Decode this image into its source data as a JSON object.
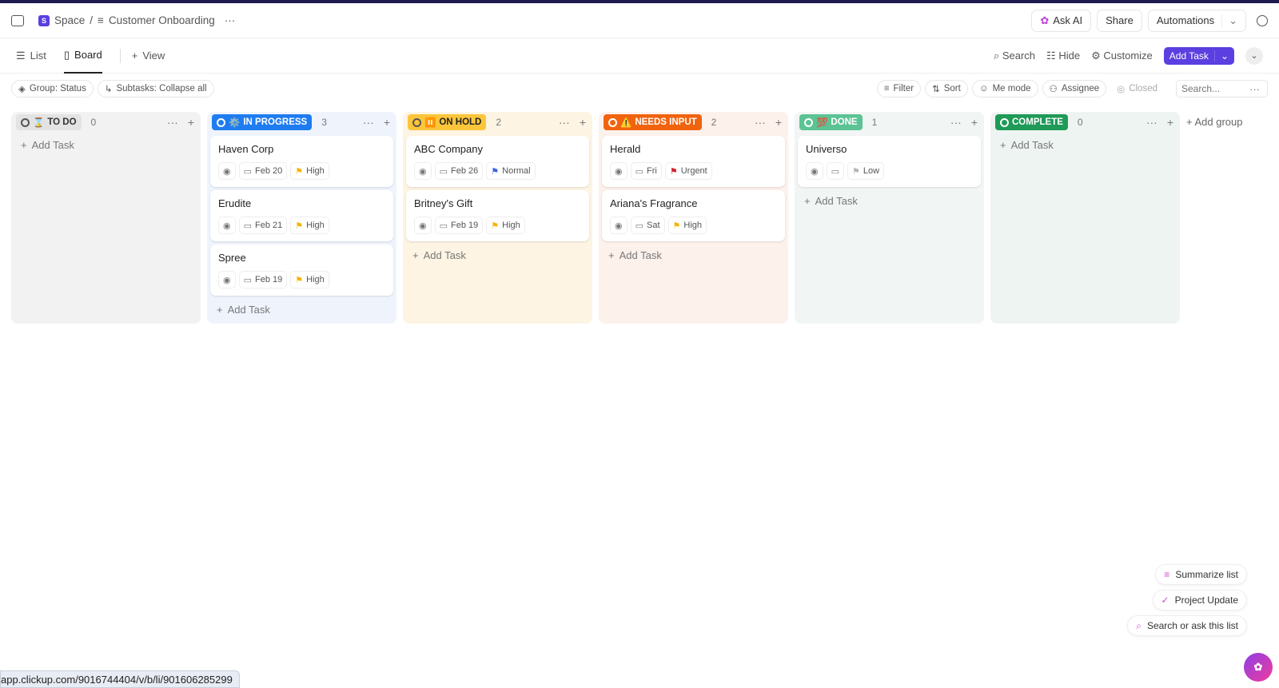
{
  "header": {
    "space": "Space",
    "space_initial": "S",
    "separator": "/",
    "list_name": "Customer Onboarding",
    "more": "···",
    "ask_ai": "Ask AI",
    "share": "Share",
    "automations": "Automations"
  },
  "views": {
    "list": "List",
    "board": "Board",
    "add_view": "View",
    "search": "Search",
    "hide": "Hide",
    "customize": "Customize",
    "add_task": "Add Task"
  },
  "filters": {
    "group": "Group: Status",
    "subtasks": "Subtasks: Collapse all",
    "filter": "Filter",
    "sort": "Sort",
    "me_mode": "Me mode",
    "assignee": "Assignee",
    "closed": "Closed",
    "search_placeholder": "Search..."
  },
  "columns": [
    {
      "name": "TO DO",
      "emoji": "⌛",
      "count": "0",
      "color": "#e3e3e3",
      "text": "#333",
      "bg": "#f2f2f2",
      "tasks": []
    },
    {
      "name": "IN PROGRESS",
      "emoji": "⚙️",
      "count": "3",
      "color": "#1f7cf0",
      "text": "#fff",
      "bg": "#eff4fc",
      "tasks": [
        {
          "title": "Haven Corp",
          "date": "Feb 20",
          "priority": "High",
          "flag": "#f5b400"
        },
        {
          "title": "Erudite",
          "date": "Feb 21",
          "priority": "High",
          "flag": "#f5b400"
        },
        {
          "title": "Spree",
          "date": "Feb 19",
          "priority": "High",
          "flag": "#f5b400"
        }
      ]
    },
    {
      "name": "ON HOLD",
      "emoji": "⏸️",
      "count": "2",
      "color": "#fcc63a",
      "text": "#222",
      "bg": "#fdf4e3",
      "tasks": [
        {
          "title": "ABC Company",
          "date": "Feb 26",
          "priority": "Normal",
          "flag": "#3d63e0"
        },
        {
          "title": "Britney's Gift",
          "date": "Feb 19",
          "priority": "High",
          "flag": "#f5b400"
        }
      ]
    },
    {
      "name": "NEEDS INPUT",
      "emoji": "⚠️",
      "count": "2",
      "color": "#f0640f",
      "text": "#fff",
      "bg": "#fdf1ec",
      "tasks": [
        {
          "title": "Herald",
          "date": "Fri",
          "priority": "Urgent",
          "flag": "#d3202a"
        },
        {
          "title": "Ariana's Fragrance",
          "date": "Sat",
          "priority": "High",
          "flag": "#f5b400"
        }
      ]
    },
    {
      "name": "DONE",
      "emoji": "💯",
      "count": "1",
      "color": "#5cc394",
      "text": "#fff",
      "bg": "#f1f6f4",
      "tasks": [
        {
          "title": "Universo",
          "date": "",
          "priority": "Low",
          "flag": "#b5b5b5"
        }
      ]
    },
    {
      "name": "COMPLETE",
      "emoji": "",
      "count": "0",
      "color": "#1f9a58",
      "text": "#fff",
      "bg": "#eef4f1",
      "tasks": []
    }
  ],
  "add_task_label": "Add Task",
  "add_group": "Add group",
  "ai_actions": {
    "summarize": "Summarize list",
    "project_update": "Project Update",
    "search_ask": "Search or ask this list"
  },
  "status_url": "app.clickup.com/9016744404/v/b/li/901606285299"
}
